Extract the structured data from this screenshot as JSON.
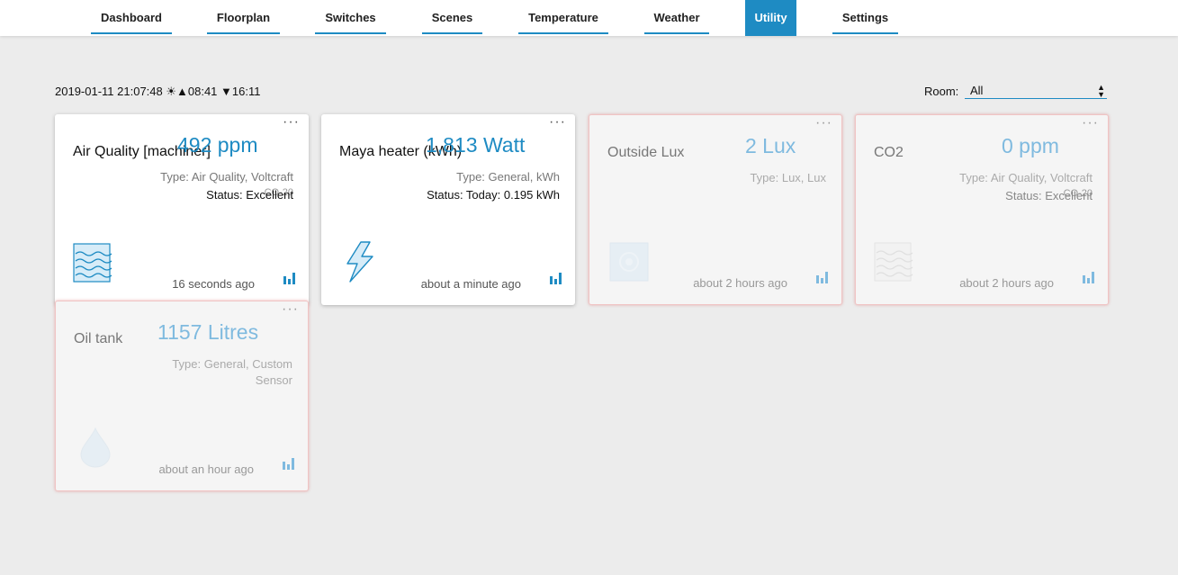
{
  "nav": {
    "tabs": [
      {
        "label": "Dashboard"
      },
      {
        "label": "Floorplan"
      },
      {
        "label": "Switches"
      },
      {
        "label": "Scenes"
      },
      {
        "label": "Temperature"
      },
      {
        "label": "Weather"
      },
      {
        "label": "Utility"
      },
      {
        "label": "Settings"
      }
    ],
    "active": "Utility"
  },
  "header": {
    "datetime": "2019-01-11 21:07:48 ☀▲08:41 ▼16:11",
    "room_label": "Room:",
    "room_selected": "All"
  },
  "colors": {
    "accent": "#1e8bc3",
    "accent_faded": "#7fbadf",
    "timeout_border": "#f0c4c4"
  },
  "cards": [
    {
      "name": "Air Quality [machiner]",
      "value": "492 ppm",
      "type": "Type: Air Quality, Voltcraft",
      "subvalue": "CO-20",
      "status": "Status: Excellent",
      "updated": "16 seconds ago",
      "icon": "air-quality-icon",
      "timedout": false
    },
    {
      "name": "Maya heater (kWh)",
      "value": "1,813 Watt",
      "type": "Type: General, kWh",
      "status": "Status: Today: 0.195 kWh",
      "updated": "about a minute ago",
      "icon": "lightning-icon",
      "timedout": false
    },
    {
      "name": "Outside Lux",
      "value": "2 Lux",
      "type": "Type: Lux, Lux",
      "updated": "about 2 hours ago",
      "icon": "lux-icon",
      "timedout": true
    },
    {
      "name": "CO2",
      "value": "0 ppm",
      "type": "Type: Air Quality, Voltcraft",
      "subvalue": "CO-20",
      "status": "Status: Excellent",
      "updated": "about 2 hours ago",
      "icon": "air-quality-icon",
      "timedout": true
    },
    {
      "name": "Oil tank",
      "value": "1157 Litres",
      "type_line1": "Type: General, Custom",
      "type_line2": "Sensor",
      "updated": "about an hour ago",
      "icon": "drop-icon",
      "timedout": true
    }
  ]
}
